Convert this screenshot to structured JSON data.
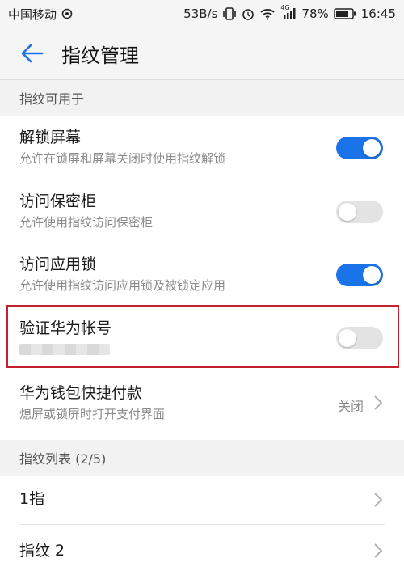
{
  "status_bar": {
    "carrier": "中国移动",
    "speed": "53B/s",
    "network": "4G",
    "battery": "78%",
    "time": "16:45"
  },
  "app_bar": {
    "title": "指纹管理"
  },
  "section_usage": {
    "header": "指纹可用于",
    "items": [
      {
        "title": "解锁屏幕",
        "subtitle": "允许在锁屏和屏幕关闭时使用指纹解锁",
        "enabled": true
      },
      {
        "title": "访问保密柜",
        "subtitle": "允许使用指纹访问保密柜",
        "enabled": false
      },
      {
        "title": "访问应用锁",
        "subtitle": "允许使用指纹访问应用锁及被锁定应用",
        "enabled": true
      },
      {
        "title": "验证华为帐号",
        "subtitle": "",
        "enabled": false
      }
    ],
    "wallet": {
      "title": "华为钱包快捷付款",
      "subtitle": "熄屏或锁屏时打开支付界面",
      "value": "关闭"
    }
  },
  "section_list": {
    "header": "指纹列表 (2/5)",
    "items": [
      {
        "title": "1指"
      },
      {
        "title": "指纹 2"
      }
    ]
  },
  "colors": {
    "accent": "#1a73e8",
    "highlight": "#c3202b"
  }
}
